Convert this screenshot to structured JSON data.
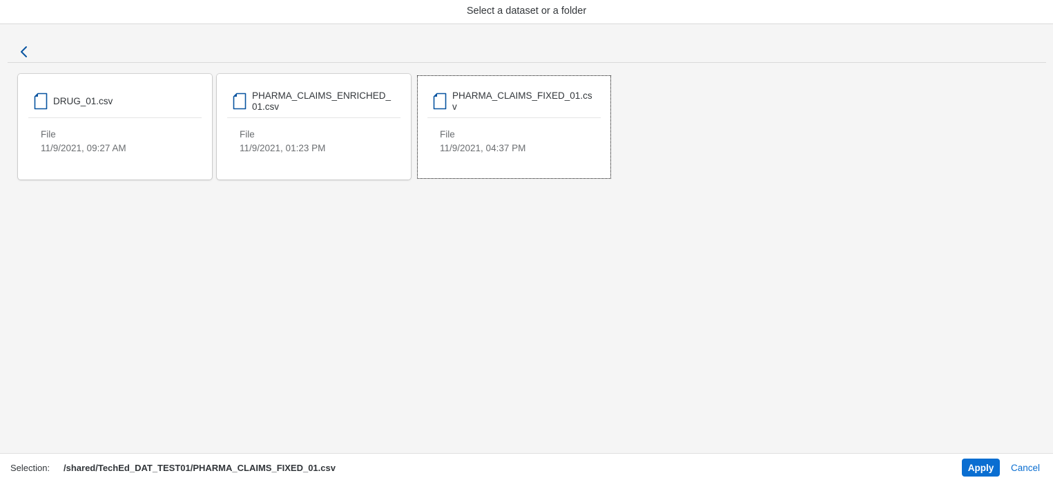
{
  "dialog": {
    "title": "Select a dataset or a folder"
  },
  "toolbar": {
    "back_icon": "chevron-left-icon"
  },
  "files": [
    {
      "name": "DRUG_01.csv",
      "type": "File",
      "date": "11/9/2021, 09:27 AM",
      "icon": "file-icon",
      "selected": false
    },
    {
      "name": "PHARMA_CLAIMS_ENRICHED_01.csv",
      "type": "File",
      "date": "11/9/2021, 01:23 PM",
      "icon": "file-icon",
      "selected": false
    },
    {
      "name": "PHARMA_CLAIMS_FIXED_01.csv",
      "type": "File",
      "date": "11/9/2021, 04:37 PM",
      "icon": "file-icon",
      "selected": true
    }
  ],
  "footer": {
    "selection_label": "Selection:",
    "selection_value": "/shared/TechEd_DAT_TEST01/PHARMA_CLAIMS_FIXED_01.csv",
    "apply_label": "Apply",
    "cancel_label": "Cancel"
  },
  "colors": {
    "accent": "#0a6ed1",
    "icon": "#0854a0",
    "content_background": "#f5f5f5"
  }
}
